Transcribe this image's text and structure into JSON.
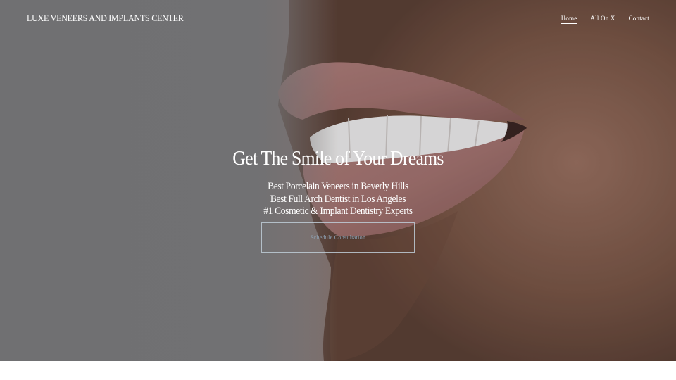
{
  "site": {
    "logo_text": "LUXE VENEERS AND IMPLANTS CENTER"
  },
  "nav": {
    "items": [
      {
        "label": "Home",
        "active": true
      },
      {
        "label": "All On X",
        "active": false
      },
      {
        "label": "Contact",
        "active": false
      }
    ]
  },
  "hero": {
    "headline": "Get The Smile of Your Dreams",
    "sublines": [
      "Best Porcelain Veneers in Beverly Hills",
      "Best Full Arch Dentist in Los Angeles",
      "#1 Cosmetic & Implant Dentistry Experts"
    ],
    "cta_label": "Schedule Consultation"
  },
  "colors": {
    "text": "#ffffff",
    "cta_text": "#8ea2b4",
    "page_background": "#ffffff"
  }
}
